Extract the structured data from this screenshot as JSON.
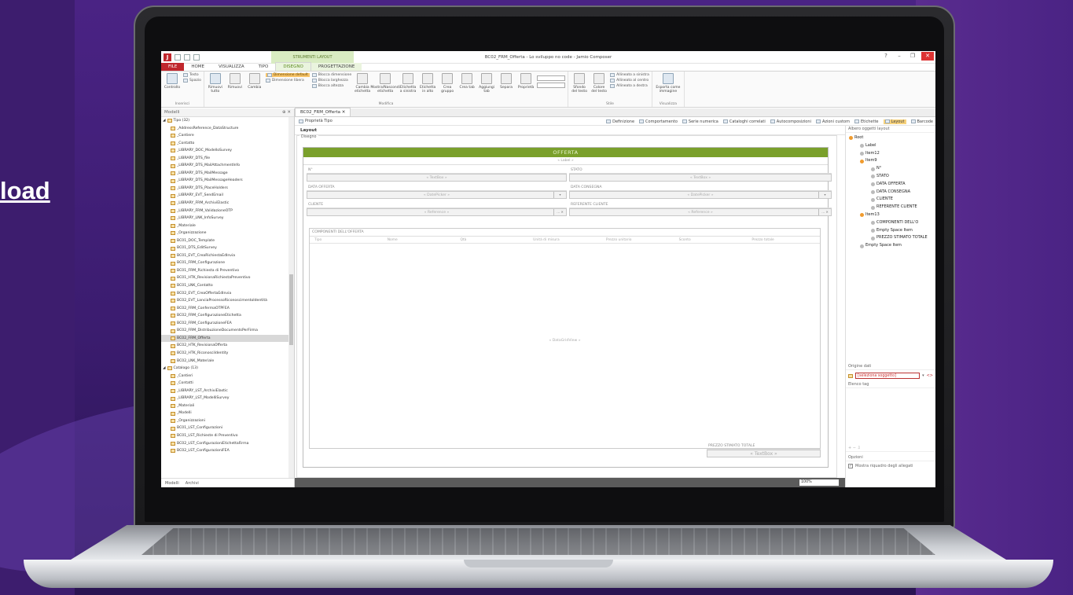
{
  "hero": {
    "link_text": "load"
  },
  "window": {
    "title": "BC02_FRM_Offerta - Lo sviluppo no code - Jamio Composer",
    "context_tab": "STRUMENTI LAYOUT"
  },
  "ribbon_tabs": [
    "FILE",
    "HOME",
    "VISUALIZZA",
    "TIPO",
    "DISEGNO",
    "PROGETTAZIONE"
  ],
  "ribbon": {
    "inserisci": {
      "label": "Inserisci",
      "controllo": "Controllo",
      "testo": "Testo",
      "spazio": "Spazio"
    },
    "modifica": {
      "label": "Modifica",
      "rimuovi_tutto": "Rimuovi tutto",
      "rimuovi": "Rimuovi",
      "cambia": "Cambia",
      "dim_default": "Dimensione default",
      "dim_libera": "Dimensione libera",
      "blocca_dim": "Blocca dimensione",
      "blocca_larg": "Blocca larghezza",
      "blocca_alt": "Blocca altezza",
      "cambia_etichetta": "Cambia etichetta",
      "mostra_nascondi": "Mostra/Nascondi etichetta",
      "etichetta_sinistra": "Etichetta a sinistra",
      "etichetta_alto": "Etichetta in alto",
      "crea_gruppo": "Crea gruppo",
      "crea_tab": "Crea tab",
      "aggiungi_tab": "Aggiungi tab",
      "separa": "Separa",
      "proprieta": "Proprietà"
    },
    "stile": {
      "label": "Stile",
      "sfondo": "Sfondo del testo",
      "colore": "Colore del testo",
      "allinea_sx": "Allineato a sinistra",
      "allinea_centro": "Allineato al centro",
      "allinea_dx": "Allineato a destra"
    },
    "visualizza": {
      "label": "Visualizza",
      "esporta": "Esporta come immagine"
    }
  },
  "models_panel": {
    "title": "Modelli",
    "items": [
      {
        "text": "Tipo (32)",
        "group": true
      },
      {
        "text": "_AddressReference_DataStructure"
      },
      {
        "text": "_Cantiere"
      },
      {
        "text": "_Contatto"
      },
      {
        "text": "_LIBRARY_DOC_ModelloSurvey"
      },
      {
        "text": "_LIBRARY_DTS_file"
      },
      {
        "text": "_LIBRARY_DTS_MailAttachmentInfo"
      },
      {
        "text": "_LIBRARY_DTS_MailMessage"
      },
      {
        "text": "_LIBRARY_DTS_MailMessageHeaders"
      },
      {
        "text": "_LIBRARY_DTS_PlaceHolders"
      },
      {
        "text": "_LIBRARY_EVT_SendEmail"
      },
      {
        "text": "_LIBRARY_FRM_ArchiviElastic"
      },
      {
        "text": "_LIBRARY_FRM_ValidazioneOTP"
      },
      {
        "text": "_LIBRARY_LNK_InfoSurvey"
      },
      {
        "text": "_Materiale"
      },
      {
        "text": "_Organizzazione"
      },
      {
        "text": "BC01_DOC_Template"
      },
      {
        "text": "BC01_DTS_EditSurvey"
      },
      {
        "text": "BC01_EVT_CreaRichiestaEdInvia"
      },
      {
        "text": "BC01_FRM_Configurazione"
      },
      {
        "text": "BC01_FRM_Richiesta di Preventivo"
      },
      {
        "text": "BC01_HTK_RevisionaRichiestaPreventivo"
      },
      {
        "text": "BC01_LNK_Contatto"
      },
      {
        "text": "BC02_EVT_CreaOffertaEdInvia"
      },
      {
        "text": "BC02_EVT_LanciaProcessoRiconoscimentoIdentità"
      },
      {
        "text": "BC02_FRM_ConfermaOTPFEA"
      },
      {
        "text": "BC02_FRM_ConfigurazioneEtichetta"
      },
      {
        "text": "BC02_FRM_ConfigurazioneFEA"
      },
      {
        "text": "BC02_FRM_DistribuzioneDocumentsPerFirma"
      },
      {
        "text": "BC02_FRM_Offerta",
        "selected": true
      },
      {
        "text": "BC02_HTK_RevisionaOfferta"
      },
      {
        "text": "BC02_HTK_RiconosciIdentity"
      },
      {
        "text": "BC02_LNK_Materiale"
      },
      {
        "text": "Catalogo (13)",
        "group": true
      },
      {
        "text": "_Cantieri"
      },
      {
        "text": "_Contatti"
      },
      {
        "text": "_LIBRARY_LST_ArchiviElastic"
      },
      {
        "text": "_LIBRARY_LST_ModelliSurvey"
      },
      {
        "text": "_Materiali"
      },
      {
        "text": "_Modelli"
      },
      {
        "text": "_Organizzazioni"
      },
      {
        "text": "BC01_LST_Configurazioni"
      },
      {
        "text": "BC01_LST_Richieste di Preventivo"
      },
      {
        "text": "BC02_LST_ConfigurazioniEtichettaFirma"
      },
      {
        "text": "BC02_LST_ConfigurazioniFEA"
      }
    ],
    "footer_tabs": [
      "Modelli",
      "Archivi"
    ]
  },
  "document": {
    "tab": "BC02_FRM_Offerta",
    "properties_label": "Proprietà Tipo",
    "toolstrip": [
      "Definizione",
      "Comportamento",
      "Serie numerica",
      "Cataloghi correlati",
      "Autocomposizioni",
      "Azioni custom",
      "Etichette",
      "Layout",
      "Barcode"
    ],
    "layout_label": "Layout",
    "designer_label": "Disegno",
    "form_title": "OFFERTA",
    "label_placeholder": "« Label »",
    "fields": {
      "nr": "N°",
      "stato": "STATO",
      "data_offerta": "DATA OFFERTA",
      "data_consegna": "DATA CONSEGNA",
      "cliente": "CLIENTE",
      "referente": "REFERENTE CLIENTE",
      "textbox": "« TextBox »",
      "datepicker": "« DatePicker »",
      "reference": "« Reference »"
    },
    "grid": {
      "title": "COMPONENTI DELL'OFFERTA",
      "columns": [
        "Tipo",
        "Nome",
        "Qtà",
        "Unità di misura",
        "Prezzo unitario",
        "Sconto",
        "Prezzo totale"
      ],
      "placeholder": "« DataGridView »"
    },
    "prezzo": {
      "label": "PREZZO STIMATO TOTALE",
      "value": "« TextBox »"
    },
    "zoom": "100%"
  },
  "right_panel": {
    "tree_title": "Albero oggetti layout",
    "tree": [
      {
        "text": "Root",
        "level": 0
      },
      {
        "text": "Label",
        "level": 1
      },
      {
        "text": "Item12",
        "level": 1
      },
      {
        "text": "Item9",
        "level": 1
      },
      {
        "text": "N°",
        "level": 2
      },
      {
        "text": "STATO",
        "level": 2
      },
      {
        "text": "DATA OFFERTA",
        "level": 2
      },
      {
        "text": "DATA CONSEGNA",
        "level": 2
      },
      {
        "text": "CLIENTE",
        "level": 2
      },
      {
        "text": "REFERENTE CLIENTE",
        "level": 2
      },
      {
        "text": "Item13",
        "level": 1
      },
      {
        "text": "COMPONENTI DELL'O",
        "level": 2
      },
      {
        "text": "Empty Space Item",
        "level": 2
      },
      {
        "text": "PREZZO STIMATO TOTALE",
        "level": 2
      },
      {
        "text": "Empty Space Item",
        "level": 1
      }
    ],
    "origine_title": "Origine dati",
    "origine_value": "[seleziona soggetto]",
    "elenco_tag": "Elenco tag",
    "opzioni": "Opzioni",
    "mostra_riquadro": "Mostra riquadro degli allegati"
  }
}
